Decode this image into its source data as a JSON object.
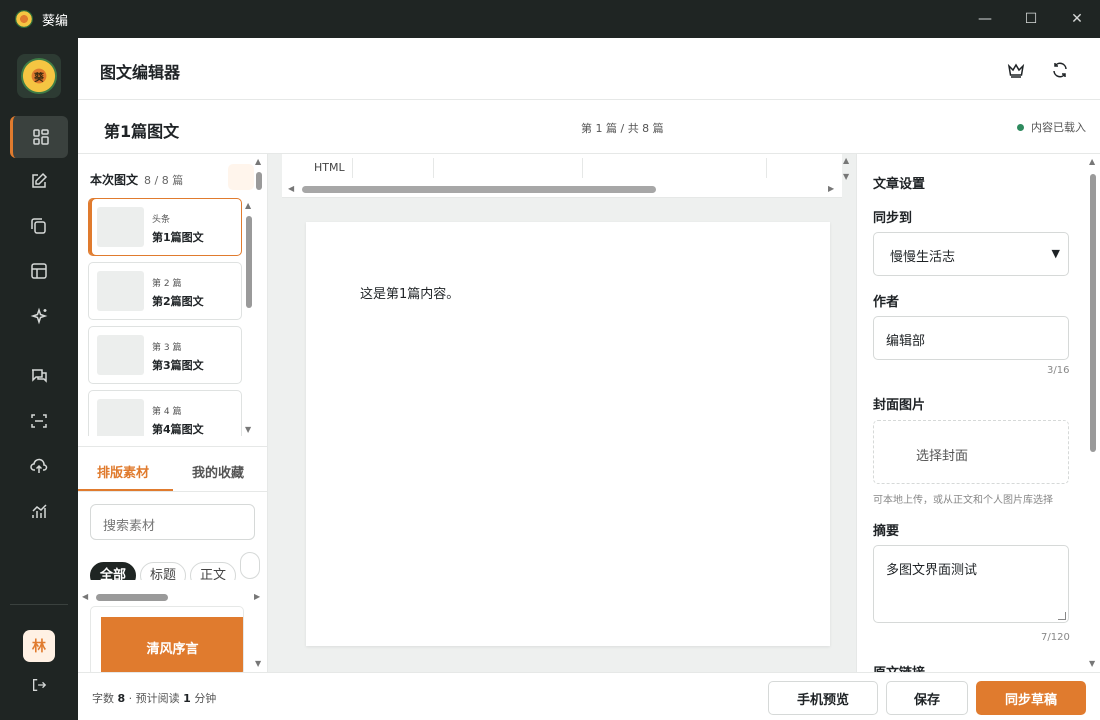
{
  "window": {
    "app_name": "葵编",
    "controls": {
      "minimize": "—",
      "maximize": "☐",
      "close": "✕"
    }
  },
  "rail": {
    "logo_text": "葵",
    "avatar_text": "林",
    "items": [
      {
        "icon": "grid-icon",
        "active": true
      },
      {
        "icon": "edit-icon"
      },
      {
        "icon": "copy-icon"
      },
      {
        "icon": "layout-icon"
      },
      {
        "icon": "sparkle-icon"
      },
      {
        "icon": "chat-icon"
      },
      {
        "icon": "scan-icon"
      },
      {
        "icon": "cloud-upload-icon"
      },
      {
        "icon": "analytics-icon"
      }
    ]
  },
  "header": {
    "title": "图文编辑器"
  },
  "subheader": {
    "doc_title": "第1篇图文",
    "pager": "第 1 篇 / 共 8 篇",
    "status": "内容已载入",
    "status_color": "#2e8a5e"
  },
  "left_panel": {
    "heading": "本次图文",
    "count": "8 / 8 篇",
    "articles": [
      {
        "tag": "头条",
        "name": "第1篇图文"
      },
      {
        "tag": "第 2 篇",
        "name": "第2篇图文"
      },
      {
        "tag": "第 3 篇",
        "name": "第3篇图文"
      },
      {
        "tag": "第 4 篇",
        "name": "第4篇图文"
      }
    ],
    "tabs": [
      "排版素材",
      "我的收藏"
    ],
    "search_placeholder": "搜索素材",
    "chips": [
      "全部",
      "标题",
      "正文",
      ""
    ],
    "material_banner": "清风序言"
  },
  "editor": {
    "toolbar_label": "HTML",
    "content": "这是第1篇内容。"
  },
  "right_panel": {
    "section_title": "文章设置",
    "sync_label": "同步到",
    "sync_value": "慢慢生活志",
    "author_label": "作者",
    "author_value": "编辑部",
    "author_count": "3/16",
    "cover_label": "封面图片",
    "cover_button": "选择封面",
    "cover_hint": "可本地上传，或从正文和个人图片库选择",
    "summary_label": "摘要",
    "summary_value": "多图文界面测试",
    "summary_count": "7/120",
    "original_link_label": "原文链接"
  },
  "footer": {
    "word_label": "字数",
    "word_count": "8",
    "read_label": "· 预计阅读",
    "read_minutes": "1",
    "read_unit": "分钟",
    "preview_button": "手机预览",
    "save_button": "保存",
    "sync_button": "同步草稿"
  },
  "colors": {
    "accent": "#e07b2e",
    "sidebar": "#1f2523"
  }
}
